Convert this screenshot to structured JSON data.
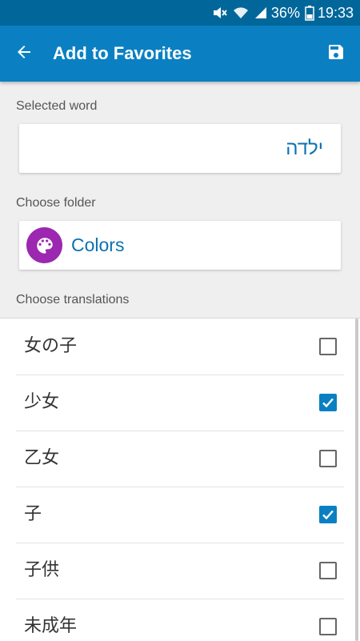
{
  "status_bar": {
    "battery": "36%",
    "time": "19:33"
  },
  "app_bar": {
    "title": "Add to Favorites",
    "back_icon": "arrow-back-icon",
    "save_icon": "save-icon"
  },
  "selected_word": {
    "label": "Selected word",
    "value": "ילדה"
  },
  "folder": {
    "label": "Choose folder",
    "name": "Colors",
    "icon": "palette-icon",
    "icon_color": "#9c27b0"
  },
  "translations": {
    "label": "Choose translations",
    "items": [
      {
        "text": "女の子",
        "checked": false
      },
      {
        "text": "少女",
        "checked": true
      },
      {
        "text": "乙女",
        "checked": false
      },
      {
        "text": "子",
        "checked": true
      },
      {
        "text": "子供",
        "checked": false
      },
      {
        "text": "未成年",
        "checked": false
      }
    ]
  },
  "colors": {
    "status_bar": "#01679b",
    "app_bar": "#0a80c2",
    "accent_text": "#0a72b0"
  }
}
